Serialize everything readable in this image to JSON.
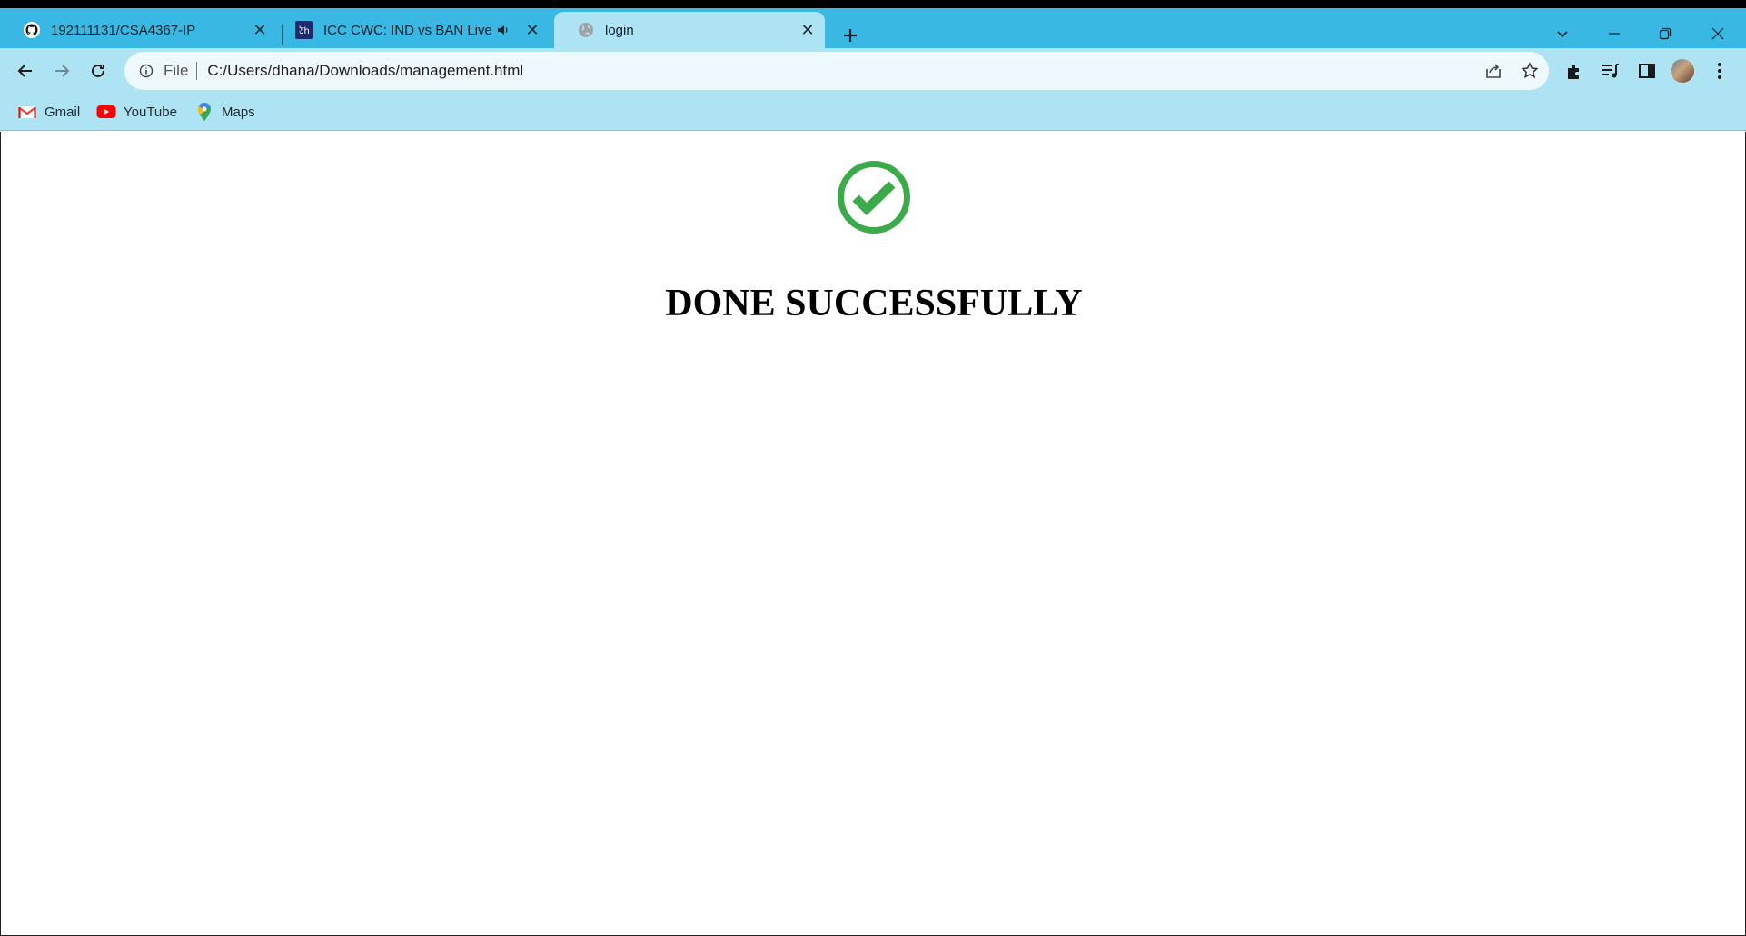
{
  "browser": {
    "tabs": [
      {
        "title": "192111131/CSA4367-IP",
        "favicon": "github-icon"
      },
      {
        "title": "ICC CWC: IND vs BAN Live s",
        "favicon": "news-site-icon",
        "audio": true
      },
      {
        "title": "login",
        "favicon": "globe-icon",
        "active": true
      }
    ],
    "omnibox": {
      "scheme_label": "File",
      "url": "C:/Users/dhana/Downloads/management.html"
    },
    "bookmarks": [
      {
        "label": "Gmail",
        "icon": "gmail-icon"
      },
      {
        "label": "YouTube",
        "icon": "youtube-icon"
      },
      {
        "label": "Maps",
        "icon": "maps-icon"
      }
    ],
    "colors": {
      "tabbar": "#3ab8e4",
      "toolbar": "#aee3f3",
      "omnibox": "#eef9fd"
    }
  },
  "page": {
    "heading": "DONE SUCCESSFULLY",
    "status_icon": "check-circle-icon",
    "status_color": "#3bab4a"
  }
}
